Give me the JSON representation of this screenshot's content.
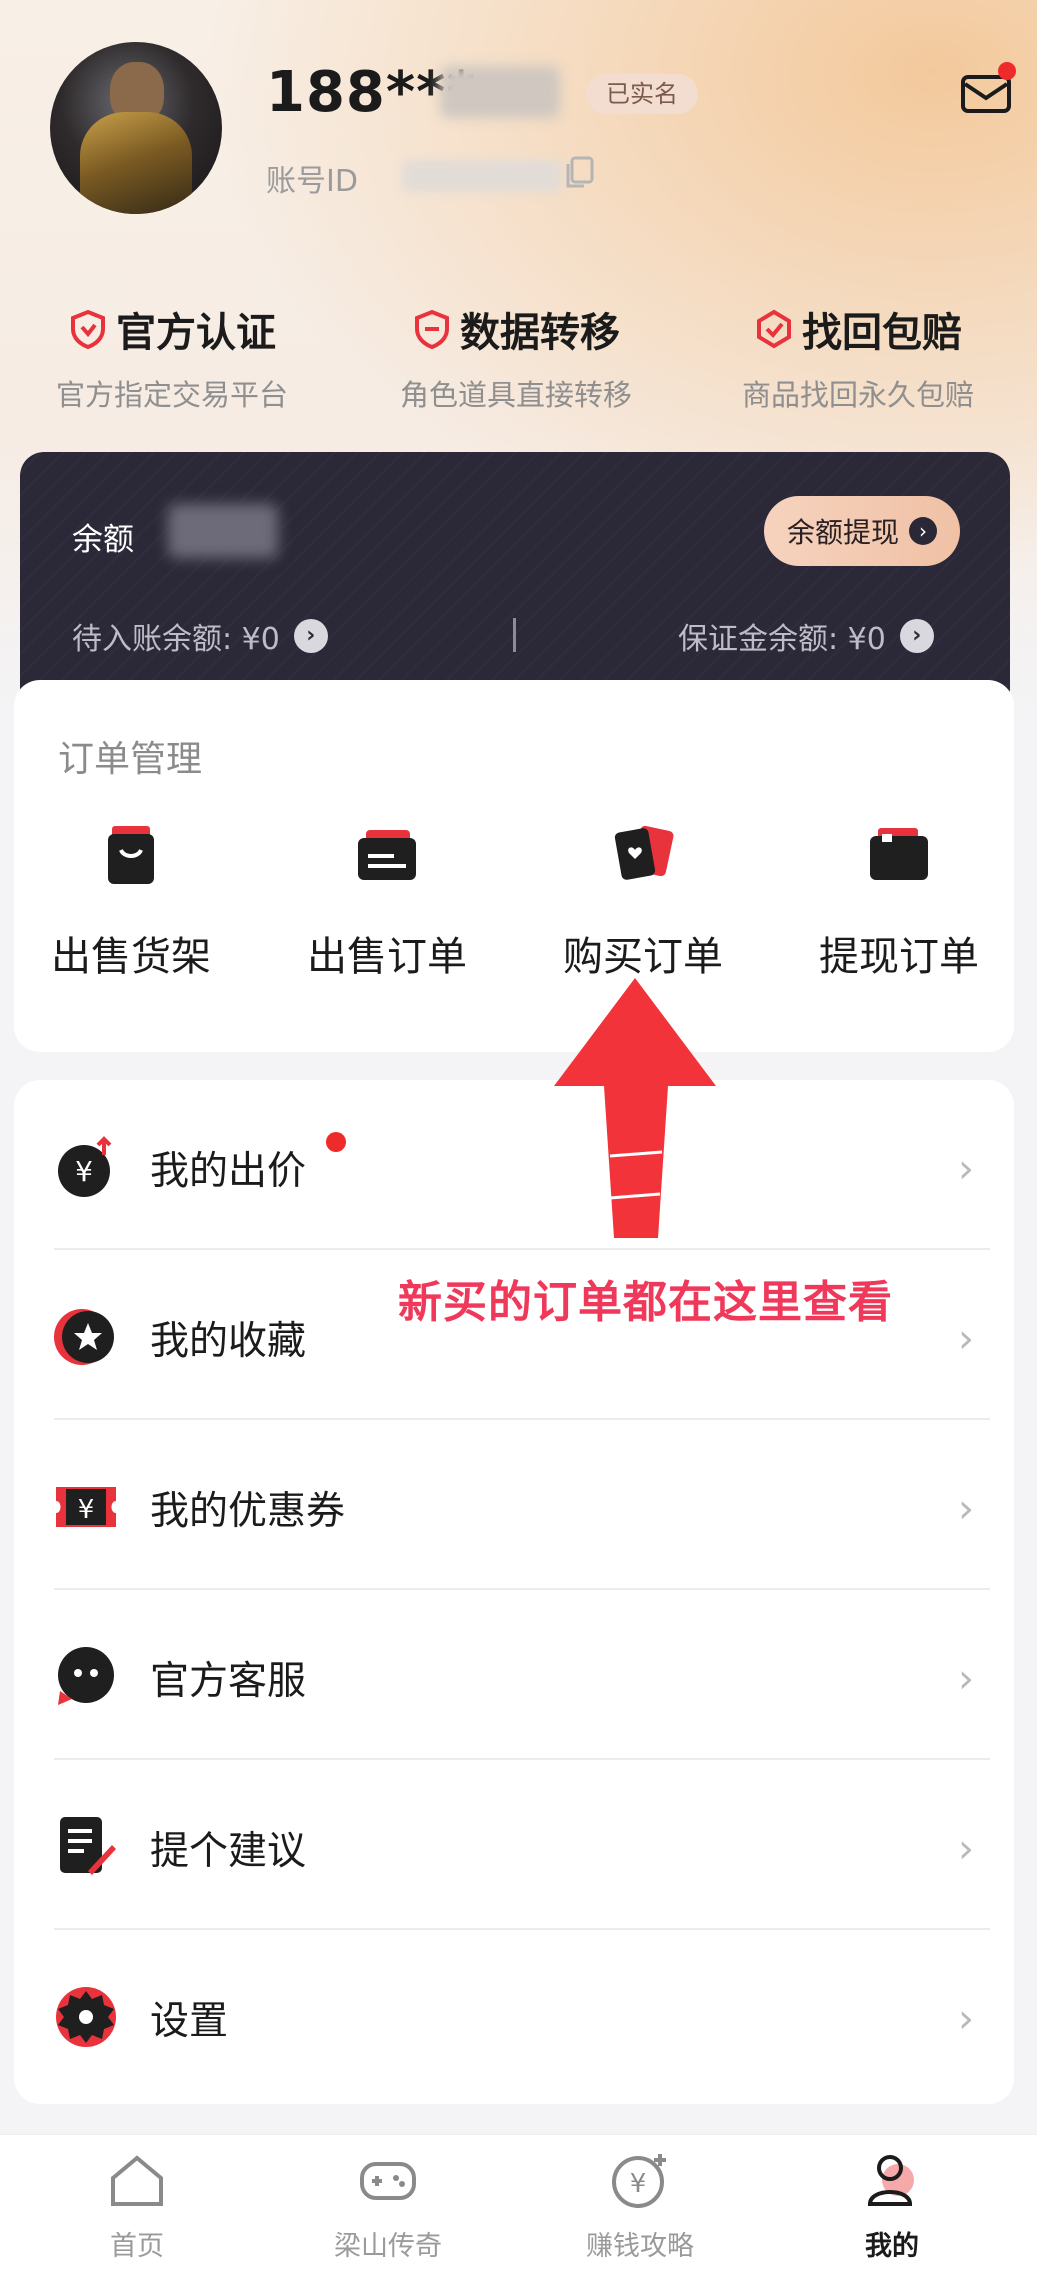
{
  "profile": {
    "phone": "188***",
    "verified_badge": "已实名",
    "account_label": "账号ID"
  },
  "features": [
    {
      "title": "官方认证",
      "subtitle": "官方指定交易平台"
    },
    {
      "title": "数据转移",
      "subtitle": "角色道具直接转移"
    },
    {
      "title": "找回包赔",
      "subtitle": "商品找回永久包赔"
    }
  ],
  "balance": {
    "label": "余额",
    "withdraw_button": "余额提现",
    "pending": "待入账余额: ¥0",
    "deposit": "保证金余额: ¥0"
  },
  "orders": {
    "title": "订单管理",
    "items": [
      {
        "label": "出售货架",
        "icon": "bag-icon"
      },
      {
        "label": "出售订单",
        "icon": "card-icon"
      },
      {
        "label": "购买订单",
        "icon": "cards-icon"
      },
      {
        "label": "提现订单",
        "icon": "wallet-icon"
      }
    ]
  },
  "menu": {
    "items": [
      {
        "label": "我的出价",
        "icon": "bid-icon"
      },
      {
        "label": "我的收藏",
        "icon": "star-icon"
      },
      {
        "label": "我的优惠券",
        "icon": "coupon-icon"
      },
      {
        "label": "官方客服",
        "icon": "chat-icon"
      },
      {
        "label": "提个建议",
        "icon": "suggestion-icon"
      },
      {
        "label": "设置",
        "icon": "gear-icon"
      }
    ]
  },
  "annotation": "新买的订单都在这里查看",
  "tabs": [
    {
      "label": "首页",
      "icon": "home-icon"
    },
    {
      "label": "梁山传奇",
      "icon": "gamepad-icon"
    },
    {
      "label": "赚钱攻略",
      "icon": "money-icon"
    },
    {
      "label": "我的",
      "icon": "user-icon",
      "active": true
    }
  ],
  "colors": {
    "accent": "#e8333c",
    "card_bg": "#2b2938",
    "annotation": "#f0385a"
  }
}
